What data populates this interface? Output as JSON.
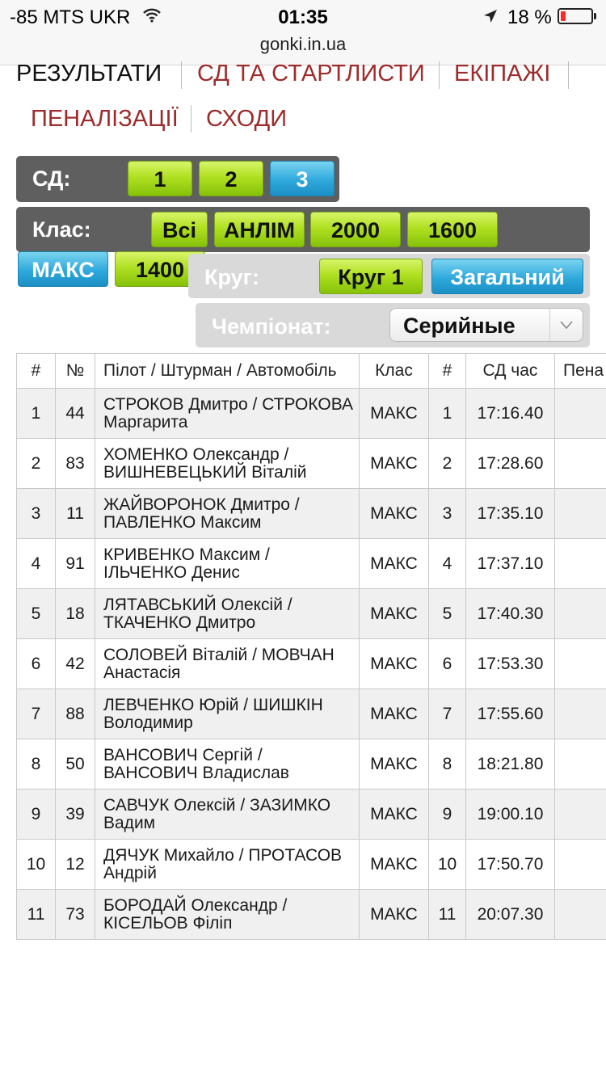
{
  "status_bar": {
    "carrier": "-85 MTS UKR",
    "time": "01:35",
    "battery_percent": "18 %",
    "battery_level": 0.18,
    "url": "gonki.in.ua"
  },
  "nav": {
    "results": "РЕЗУЛЬТАТИ",
    "stages": "СД ТА СТАРТЛИСТИ",
    "crews": "ЕКІПАЖІ",
    "penalties": "ПЕНАЛІЗАЦІЇ",
    "retirements": "СХОДИ"
  },
  "filters": {
    "sd": {
      "label": "СД:",
      "options": [
        "1",
        "2",
        "3"
      ],
      "selected": "3"
    },
    "class": {
      "label": "Клас:",
      "options": [
        "Всі",
        "АНЛІМ",
        "2000",
        "1600",
        "МАКС",
        "1400"
      ],
      "selected": "МАКС"
    },
    "lap": {
      "label": "Круг:",
      "options": [
        "Круг 1",
        "Загальний"
      ],
      "selected": "Загальний"
    },
    "championship": {
      "label": "Чемпіонат:",
      "value": "Серийные"
    }
  },
  "colors": {
    "nav_link": "#9e2b2b",
    "button_green": "#b0e021",
    "button_blue": "#2fa9dc",
    "panel_dark": "#5f5f5f"
  },
  "table": {
    "headers": [
      "#",
      "№",
      "Пілот / Штурман / Автомобіль",
      "Клас",
      "#",
      "СД час",
      "Пена"
    ],
    "rows": [
      {
        "pos": "1",
        "num": "44",
        "pilot": "СТРОКОВ Дмитро / СТРОКОВА Маргарита",
        "class": "МАКС",
        "rank": "1",
        "time": "17:16.40"
      },
      {
        "pos": "2",
        "num": "83",
        "pilot": "ХОМЕНКО Олександр / ВИШНЕВЕЦЬКИЙ Віталій",
        "class": "МАКС",
        "rank": "2",
        "time": "17:28.60"
      },
      {
        "pos": "3",
        "num": "11",
        "pilot": "ЖАЙВОРОНОК Дмитро / ПАВЛЕНКО Максим",
        "class": "МАКС",
        "rank": "3",
        "time": "17:35.10"
      },
      {
        "pos": "4",
        "num": "91",
        "pilot": "КРИВЕНКО Максим / ІЛЬЧЕНКО Денис",
        "class": "МАКС",
        "rank": "4",
        "time": "17:37.10"
      },
      {
        "pos": "5",
        "num": "18",
        "pilot": "ЛЯТАВСЬКИЙ Олексій / ТКАЧЕНКО Дмитро",
        "class": "МАКС",
        "rank": "5",
        "time": "17:40.30"
      },
      {
        "pos": "6",
        "num": "42",
        "pilot": "СОЛОВЕЙ Віталій / МОВЧАН Анастасія",
        "class": "МАКС",
        "rank": "6",
        "time": "17:53.30"
      },
      {
        "pos": "7",
        "num": "88",
        "pilot": "ЛЕВЧЕНКО Юрій / ШИШКІН Володимир",
        "class": "МАКС",
        "rank": "7",
        "time": "17:55.60"
      },
      {
        "pos": "8",
        "num": "50",
        "pilot": "ВАНСОВИЧ Сергій / ВАНСОВИЧ Владислав",
        "class": "МАКС",
        "rank": "8",
        "time": "18:21.80"
      },
      {
        "pos": "9",
        "num": "39",
        "pilot": "САВЧУК Олексій / ЗАЗИМКО Вадим",
        "class": "МАКС",
        "rank": "9",
        "time": "19:00.10"
      },
      {
        "pos": "10",
        "num": "12",
        "pilot": "ДЯЧУК Михайло / ПРОТАСОВ Андрій",
        "class": "МАКС",
        "rank": "10",
        "time": "17:50.70"
      },
      {
        "pos": "11",
        "num": "73",
        "pilot": "БОРОДАЙ Олександр / КІСЕЛЬОВ Філіп",
        "class": "МАКС",
        "rank": "11",
        "time": "20:07.30"
      }
    ]
  }
}
